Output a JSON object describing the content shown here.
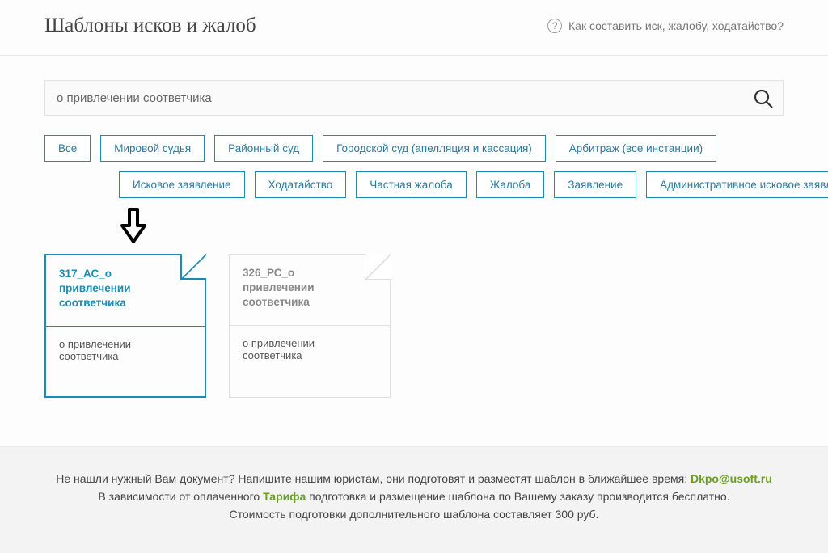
{
  "header": {
    "title": "Шаблоны исков и жалоб",
    "help_label": "Как составить иск, жалобу, ходатайство?"
  },
  "search": {
    "value": "о привлечении соответчика"
  },
  "filters": {
    "row1": [
      {
        "label": "Все"
      },
      {
        "label": "Мировой судья"
      },
      {
        "label": "Районный суд"
      },
      {
        "label": "Городской суд (апелляция и кассация)"
      },
      {
        "label": "Арбитраж (все инстанции)"
      }
    ],
    "row2": [
      {
        "label": "Исковое заявление"
      },
      {
        "label": "Ходатайство"
      },
      {
        "label": "Частная жалоба"
      },
      {
        "label": "Жалоба"
      },
      {
        "label": "Заявление"
      },
      {
        "label": "Административное исковое заявление"
      }
    ]
  },
  "cards": [
    {
      "title": "317_АС_о привлечении соответчика",
      "desc": "о привлечении соответчика",
      "active": true
    },
    {
      "title": "326_РС_о привлечении соответчика",
      "desc": "о привлечении соответчика",
      "active": false
    }
  ],
  "footer": {
    "line1a": "Не нашли нужный Вам документ? Напишите нашим юристам, они подготовят и разместят шаблон в ближайшее время: ",
    "email": "Dkpo@usoft.ru",
    "line2a": "В зависимости от оплаченного  ",
    "tariff": "Тарифа",
    "line2b": " подготовка и размещение шаблона по Вашему заказу производится бесплатно.",
    "line3": "Стоимость подготовки дополнительного шаблона составляет 300 руб."
  }
}
